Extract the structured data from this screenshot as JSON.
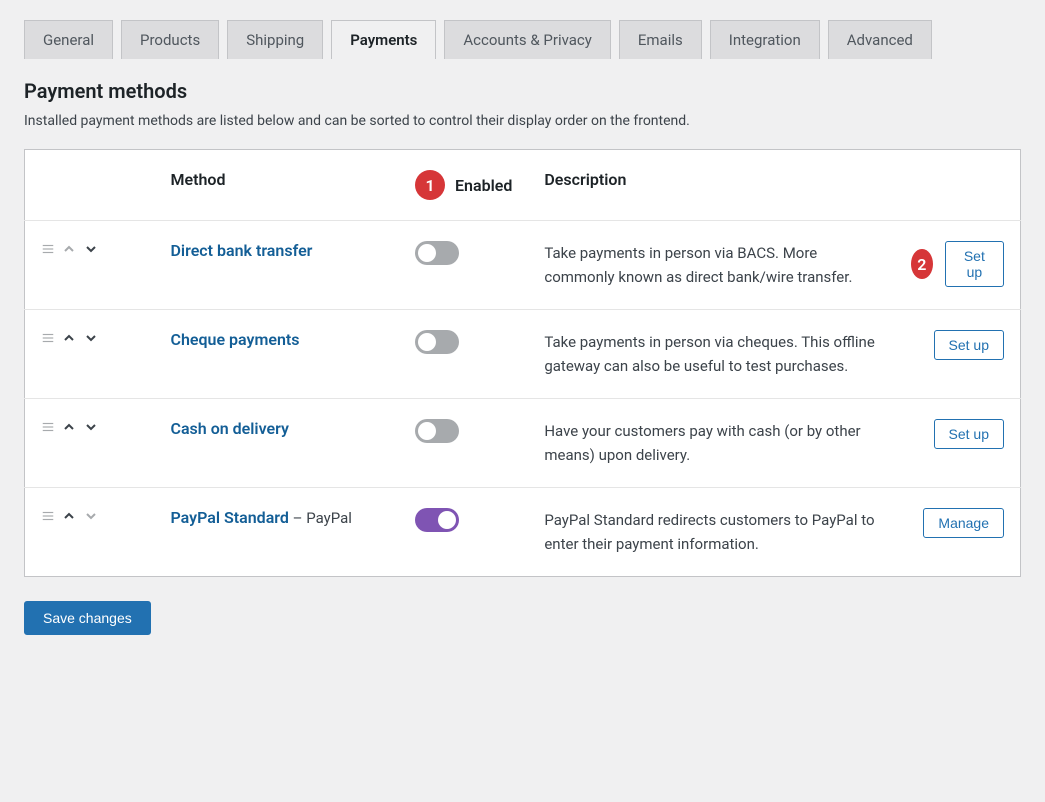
{
  "tabs": [
    {
      "label": "General",
      "active": false
    },
    {
      "label": "Products",
      "active": false
    },
    {
      "label": "Shipping",
      "active": false
    },
    {
      "label": "Payments",
      "active": true
    },
    {
      "label": "Accounts & Privacy",
      "active": false
    },
    {
      "label": "Emails",
      "active": false
    },
    {
      "label": "Integration",
      "active": false
    },
    {
      "label": "Advanced",
      "active": false
    }
  ],
  "section": {
    "title": "Payment methods",
    "description": "Installed payment methods are listed below and can be sorted to control their display order on the frontend."
  },
  "columns": {
    "method": "Method",
    "enabled": "Enabled",
    "description": "Description"
  },
  "annotations": {
    "one": "1",
    "two": "2"
  },
  "methods": [
    {
      "name": "Direct bank transfer",
      "suffix": "",
      "enabled": false,
      "description": "Take payments in person via BACS. More commonly known as direct bank/wire transfer.",
      "action_label": "Set up",
      "up_enabled": false,
      "down_enabled": true,
      "annot": true
    },
    {
      "name": "Cheque payments",
      "suffix": "",
      "enabled": false,
      "description": "Take payments in person via cheques. This offline gateway can also be useful to test purchases.",
      "action_label": "Set up",
      "up_enabled": true,
      "down_enabled": true,
      "annot": false
    },
    {
      "name": "Cash on delivery",
      "suffix": "",
      "enabled": false,
      "description": "Have your customers pay with cash (or by other means) upon delivery.",
      "action_label": "Set up",
      "up_enabled": true,
      "down_enabled": true,
      "annot": false
    },
    {
      "name": "PayPal Standard",
      "suffix": " – PayPal",
      "enabled": true,
      "description": "PayPal Standard redirects customers to PayPal to enter their payment information.",
      "action_label": "Manage",
      "up_enabled": true,
      "down_enabled": false,
      "annot": false
    }
  ],
  "save_button": "Save changes",
  "colors": {
    "accent": "#2271b1",
    "toggle_on": "#7f54b3",
    "annotation": "#d63638"
  }
}
